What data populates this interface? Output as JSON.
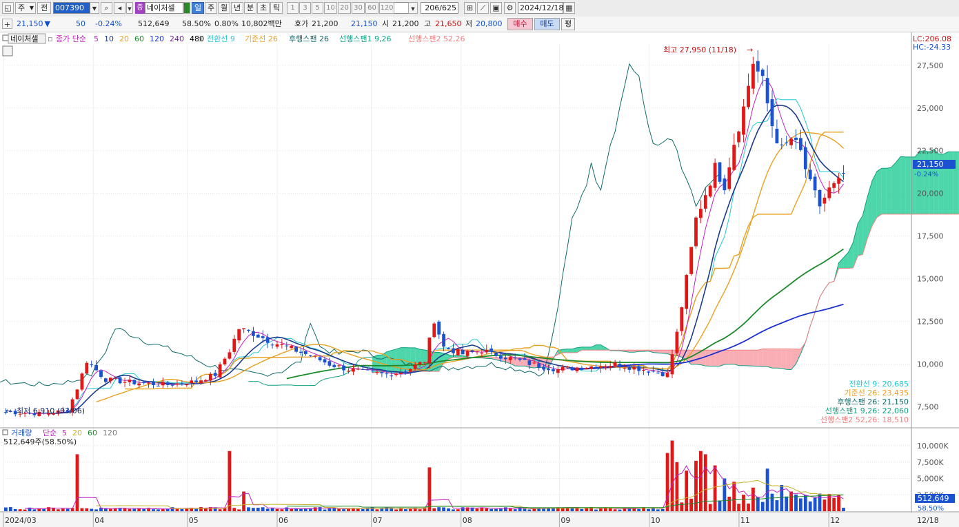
{
  "toolbar": {
    "market": "주",
    "prev": "전",
    "code": "007390",
    "stock_badge": "증",
    "stock_name": "네이처셀",
    "periods": [
      "일",
      "주",
      "월",
      "년",
      "분",
      "초",
      "틱"
    ],
    "active_period": "일",
    "numbers": [
      "1",
      "3",
      "5",
      "10",
      "20",
      "30",
      "60",
      "120"
    ],
    "count": "206/625",
    "date": "2024/12/18"
  },
  "quote": {
    "price": "21,150",
    "arrow": "▼",
    "change": "50",
    "change_pct": "-0.24%",
    "volume": "512,649",
    "vol_ratio": "58.50%",
    "turnover": "0.80%",
    "amount": "10,802백만",
    "bid_label": "호가",
    "bid": "21,200",
    "ask": "21,150",
    "open_label": "시",
    "open": "21,200",
    "high_label": "고",
    "high": "21,650",
    "low_label": "저",
    "low": "20,800",
    "buy": "매수",
    "sell": "매도",
    "eval": "평"
  },
  "legend": {
    "stock": "네이처셀",
    "ma_label": "종가 단순",
    "ma_periods": [
      "5",
      "10",
      "20",
      "60",
      "120",
      "240",
      "480"
    ],
    "ichimoku": [
      {
        "text": "전환선 9",
        "color": "#20c8d0"
      },
      {
        "text": "기준선 26",
        "color": "#e8a020"
      },
      {
        "text": "후행스팬 26",
        "color": "#106a6a"
      },
      {
        "text": "선행스팬1 9,26",
        "color": "#10a080"
      },
      {
        "text": "선행스팬2 52,26",
        "color": "#f08080"
      }
    ]
  },
  "annotations": {
    "high_label": "최고 27,950 (11/18)",
    "low_label": "최저 6,910 (03/06)",
    "lc": "LC:206.08",
    "hc": "HC:-24.33"
  },
  "right_labels": [
    {
      "text": "전환선 9: 20,685",
      "color": "#20c8d0"
    },
    {
      "text": "기준선 26: 23,435",
      "color": "#e8a020"
    },
    {
      "text": "후행스팬 26: 21,150",
      "color": "#106a6a"
    },
    {
      "text": "선행스팬1 9,26: 22,060",
      "color": "#10a080"
    },
    {
      "text": "선행스팬2 52,26: 18,510",
      "color": "#f08080"
    }
  ],
  "current_price_tag": {
    "price": "21,150",
    "pct": "-0.24%"
  },
  "volume_legend": {
    "label": "거래량",
    "ma_label": "단순",
    "periods": [
      "5",
      "20",
      "60",
      "120"
    ],
    "value": "512,649주(58.50%)"
  },
  "volume_tag": {
    "value": "512,649",
    "pct": "58.50%"
  },
  "colors": {
    "up": "#e01818",
    "down": "#1a52d0",
    "ma5": "#c020c0",
    "ma10": "#1a3a8a",
    "ma20": "#e8a020",
    "ma60": "#1a8a2a",
    "ma120": "#1a30d0",
    "ma240": "#7a1aa0",
    "ma480": "#000000"
  },
  "chart_data": {
    "type": "candlestick",
    "y_axis": {
      "ticks": [
        "27,500",
        "25,000",
        "22,500",
        "20,000",
        "17,500",
        "15,000",
        "12,500",
        "10,000",
        "7,500"
      ],
      "ylim": [
        6400,
        28700
      ]
    },
    "volume_axis": {
      "ticks": [
        "10,000K",
        "7,500K",
        "5,000K",
        "2,500K"
      ],
      "ylim": [
        0,
        11800000
      ]
    },
    "x_ticks": [
      {
        "label": "2024/03",
        "month_index": 0
      },
      {
        "label": "04",
        "month_index": 1
      },
      {
        "label": "05",
        "month_index": 2
      },
      {
        "label": "06",
        "month_index": 3
      },
      {
        "label": "07",
        "month_index": 4
      },
      {
        "label": "08",
        "month_index": 5
      },
      {
        "label": "09",
        "month_index": 6
      },
      {
        "label": "10",
        "month_index": 7
      },
      {
        "label": "11",
        "month_index": 8
      },
      {
        "label": "12",
        "month_index": 9
      }
    ],
    "x_end_label": "12/18",
    "anchors": [
      {
        "t": 0,
        "c": 7200
      },
      {
        "t": 8,
        "c": 7100
      },
      {
        "t": 13,
        "c": 7300
      },
      {
        "t": 15,
        "c": 8600
      },
      {
        "t": 17,
        "c": 10200
      },
      {
        "t": 21,
        "c": 9100
      },
      {
        "t": 28,
        "c": 8900
      },
      {
        "t": 34,
        "c": 8800
      },
      {
        "t": 40,
        "c": 9000
      },
      {
        "t": 44,
        "c": 9400
      },
      {
        "t": 47,
        "c": 10800
      },
      {
        "t": 49,
        "c": 12100
      },
      {
        "t": 52,
        "c": 11800
      },
      {
        "t": 56,
        "c": 11300
      },
      {
        "t": 60,
        "c": 10900
      },
      {
        "t": 64,
        "c": 10500
      },
      {
        "t": 68,
        "c": 10000
      },
      {
        "t": 72,
        "c": 9700
      },
      {
        "t": 76,
        "c": 9500
      },
      {
        "t": 80,
        "c": 9400
      },
      {
        "t": 84,
        "c": 9600
      },
      {
        "t": 88,
        "c": 10200
      },
      {
        "t": 90,
        "c": 12600
      },
      {
        "t": 92,
        "c": 11000
      },
      {
        "t": 96,
        "c": 10600
      },
      {
        "t": 100,
        "c": 10800
      },
      {
        "t": 104,
        "c": 10500
      },
      {
        "t": 108,
        "c": 10200
      },
      {
        "t": 112,
        "c": 9900
      },
      {
        "t": 116,
        "c": 9700
      },
      {
        "t": 120,
        "c": 9800
      },
      {
        "t": 124,
        "c": 9900
      },
      {
        "t": 128,
        "c": 10000
      },
      {
        "t": 132,
        "c": 9800
      },
      {
        "t": 136,
        "c": 9600
      },
      {
        "t": 139,
        "c": 9400
      },
      {
        "t": 141,
        "c": 11800
      },
      {
        "t": 143,
        "c": 15000
      },
      {
        "t": 145,
        "c": 18500
      },
      {
        "t": 147,
        "c": 20000
      },
      {
        "t": 149,
        "c": 21500
      },
      {
        "t": 151,
        "c": 20500
      },
      {
        "t": 153,
        "c": 23000
      },
      {
        "t": 155,
        "c": 25000
      },
      {
        "t": 157,
        "c": 27700
      },
      {
        "t": 159,
        "c": 26500
      },
      {
        "t": 161,
        "c": 24000
      },
      {
        "t": 163,
        "c": 22500
      },
      {
        "t": 165,
        "c": 23200
      },
      {
        "t": 167,
        "c": 22400
      },
      {
        "t": 169,
        "c": 20500
      },
      {
        "t": 171,
        "c": 19300
      },
      {
        "t": 173,
        "c": 20200
      },
      {
        "t": 175,
        "c": 20600
      },
      {
        "t": 176,
        "c": 21150
      }
    ],
    "volume_spikes": [
      {
        "t": 15,
        "v": 8700000
      },
      {
        "t": 47,
        "v": 9200000
      },
      {
        "t": 50,
        "v": 3000000
      },
      {
        "t": 89,
        "v": 6700000
      },
      {
        "t": 139,
        "v": 8900000
      },
      {
        "t": 140,
        "v": 10800000
      },
      {
        "t": 141,
        "v": 7500000
      },
      {
        "t": 143,
        "v": 6200000
      },
      {
        "t": 145,
        "v": 7700000
      },
      {
        "t": 146,
        "v": 9200000
      },
      {
        "t": 147,
        "v": 8700000
      },
      {
        "t": 149,
        "v": 7000000
      },
      {
        "t": 151,
        "v": 5000000
      },
      {
        "t": 153,
        "v": 4500000
      },
      {
        "t": 157,
        "v": 3600000
      },
      {
        "t": 160,
        "v": 6500000
      },
      {
        "t": 163,
        "v": 4000000
      },
      {
        "t": 165,
        "v": 3000000
      }
    ],
    "last": {
      "open": 21200,
      "high": 21650,
      "low": 20800,
      "close": 21150,
      "volume": 512649
    }
  }
}
